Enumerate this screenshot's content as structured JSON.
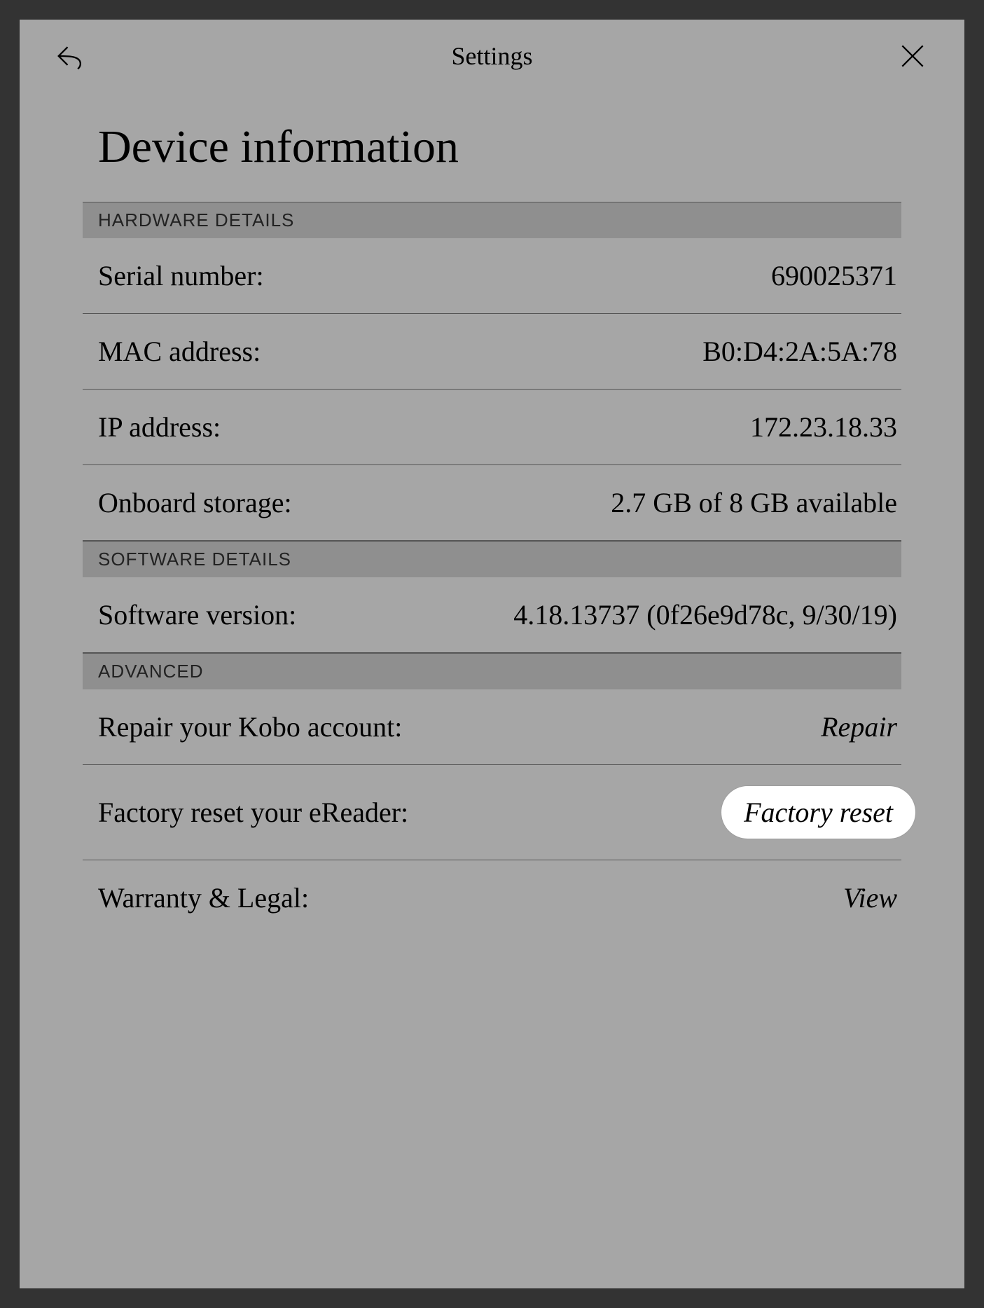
{
  "header": {
    "title": "Settings"
  },
  "page": {
    "title": "Device information"
  },
  "sections": {
    "hardware": {
      "title": "HARDWARE DETAILS",
      "serial": {
        "label": "Serial number:",
        "value": "690025371"
      },
      "mac": {
        "label": "MAC address:",
        "value": "B0:D4:2A:5A:78"
      },
      "ip": {
        "label": "IP address:",
        "value": "172.23.18.33"
      },
      "storage": {
        "label": "Onboard storage:",
        "value": "2.7 GB of 8 GB available"
      }
    },
    "software": {
      "title": "SOFTWARE DETAILS",
      "version": {
        "label": "Software version:",
        "value": "4.18.13737 (0f26e9d78c, 9/30/19)"
      }
    },
    "advanced": {
      "title": "ADVANCED",
      "repair": {
        "label": "Repair your Kobo account:",
        "action": "Repair"
      },
      "factory_reset": {
        "label": "Factory reset your eReader:",
        "action": "Factory reset"
      },
      "warranty": {
        "label": "Warranty & Legal:",
        "action": "View"
      }
    }
  }
}
